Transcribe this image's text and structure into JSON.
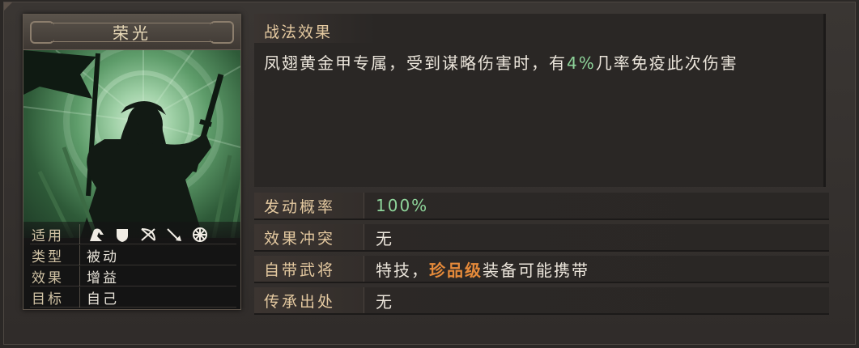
{
  "card": {
    "title": "荣光",
    "stats": [
      {
        "key": "适用",
        "value": ""
      },
      {
        "key": "类型",
        "value": "被动"
      },
      {
        "key": "效果",
        "value": "增益"
      },
      {
        "key": "目标",
        "value": "自己"
      }
    ],
    "troop_icons": [
      "cavalry-icon",
      "shield-icon",
      "bow-icon",
      "spear-icon",
      "wheel-icon"
    ]
  },
  "effect": {
    "heading": "战法效果",
    "text_before": "凤翅黄金甲专属，受到谋略伤害时，有",
    "highlight": "4%",
    "text_after": "几率免疫此次伤害"
  },
  "info": [
    {
      "key": "发动概率",
      "value": "100%"
    },
    {
      "key": "效果冲突",
      "value": "无"
    },
    {
      "key": "自带武将",
      "value_before": "特技，",
      "highlight": "珍品级",
      "value_after": "装备可能携带"
    },
    {
      "key": "传承出处",
      "value": "无"
    }
  ],
  "colors": {
    "highlight_green": "#8ed49a",
    "highlight_orange": "#e58a3a",
    "label_gold": "#e4c9a0"
  }
}
